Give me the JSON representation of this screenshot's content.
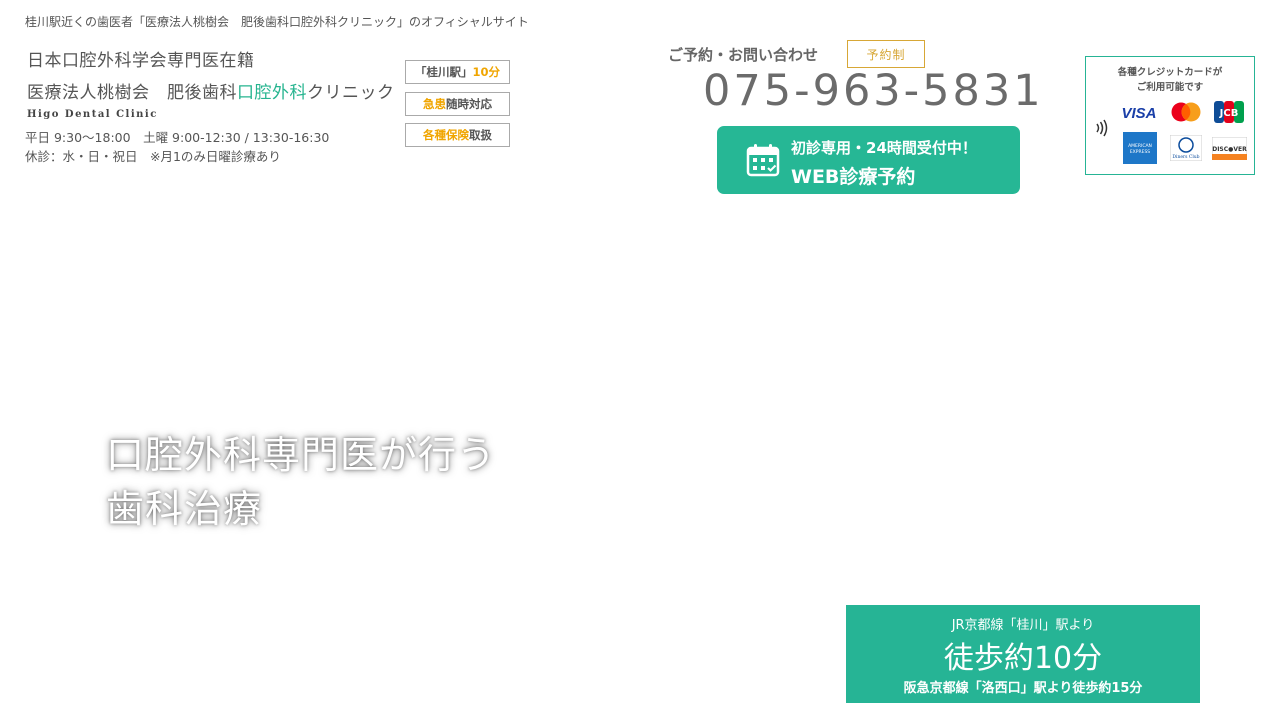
{
  "header": {
    "tagline": "桂川駅近くの歯医者「医療法人桃樹会　肥後歯科口腔外科クリニック」のオフィシャルサイト"
  },
  "logo": {
    "line1": "日本口腔外科学会専門医在籍",
    "line2_prefix": "医療法人桃樹会　肥後歯科",
    "line2_highlight": "口腔外科",
    "line2_suffix": "クリニック",
    "english": "Higo Dental Clinic"
  },
  "hours": {
    "line1": "平日 9:30〜18:00　土曜 9:00-12:30 / 13:30-16:30",
    "line2": "休診：水・日・祝日　※月1のみ日曜診療あり"
  },
  "badges": [
    {
      "part1": "「桂川駅」",
      "part2": "10分"
    },
    {
      "part1": "急患",
      "part2": "随時対応"
    },
    {
      "part1": "各種保険",
      "part2": "取扱"
    }
  ],
  "contact": {
    "label": "ご予約・お問い合わせ",
    "button_label": "予約制",
    "phone": "075-963-5831"
  },
  "web_reservation": {
    "line1": "初診専用・24時間受付中！",
    "line2": "WEB診療予約",
    "icon": "calendar-icon"
  },
  "credit": {
    "title_line1": "各種クレジットカードが",
    "title_line2": "ご利用可能です",
    "cards": [
      "VISA",
      "Mastercard",
      "JCB",
      "AMERICAN EXPRESS",
      "Diners Club",
      "DISCOVER"
    ],
    "icon": "contactless-icon"
  },
  "hero": {
    "line1": "口腔外科専門医が行う",
    "line2": "歯科治療"
  },
  "access": {
    "line1": "JR京都線「桂川」駅より",
    "line2": "徒歩約10分",
    "line3": "阪急京都線「洛西口」駅より徒歩約15分"
  },
  "colors": {
    "accent_green": "#26b495",
    "badge_orange": "#f0a500",
    "gold": "#d7a736"
  }
}
